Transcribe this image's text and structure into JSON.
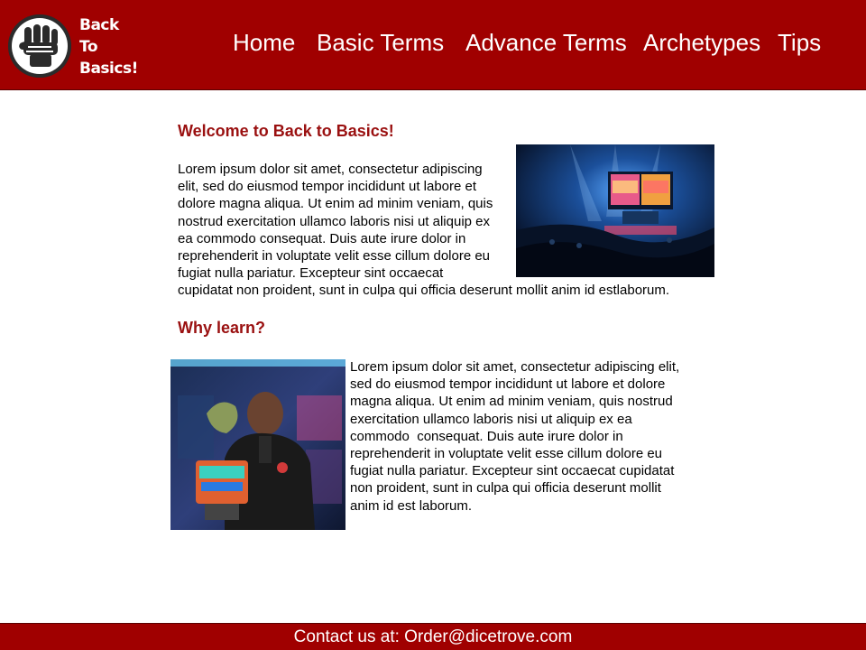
{
  "header": {
    "logo_lines": [
      "Back",
      "To",
      "Basics!"
    ],
    "nav": [
      "Home",
      "Basic Terms",
      "Advance Terms",
      "Archetypes",
      "Tips"
    ]
  },
  "section1": {
    "title": "Welcome to Back to Basics!",
    "lines": [
      "Lorem ipsum dolor sit amet, consectetur adipiscing",
      "elit, sed do eiusmod tempor incididunt ut labore et",
      "dolore magna aliqua. Ut enim ad minim veniam, quis",
      "nostrud exercitation ullamco laboris nisi ut aliquip ex",
      "ea commodo consequat. Duis aute irure dolor in",
      "reprehenderit in voluptate velit esse cillum dolore eu",
      "fugiat nulla pariatur. Excepteur sint occaecat",
      "cupidatat non proident, sunt in culpa qui officia deserunt mollit anim id estlaborum."
    ]
  },
  "section2": {
    "title": "Why learn?",
    "lines": [
      "Lorem ipsum dolor sit amet, consectetur adipiscing elit,",
      "sed do eiusmod tempor incididunt ut labore et dolore",
      "magna aliqua. Ut enim ad minim veniam, quis nostrud",
      "exercitation ullamco laboris nisi ut aliquip ex ea",
      "commodo  consequat. Duis aute irure dolor in",
      "reprehenderit in voluptate velit esse cillum dolore eu",
      "fugiat nulla pariatur. Excepteur sint occaecat cupidatat",
      "non proident, sunt in culpa qui officia deserunt mollit",
      "anim id est laborum."
    ]
  },
  "footer": {
    "contact": "Contact us at: Order@dicetrove.com"
  },
  "colors": {
    "brand_red": "#a00000",
    "heading_red": "#9a1010"
  },
  "icons": {
    "logo": "fist-icon"
  }
}
